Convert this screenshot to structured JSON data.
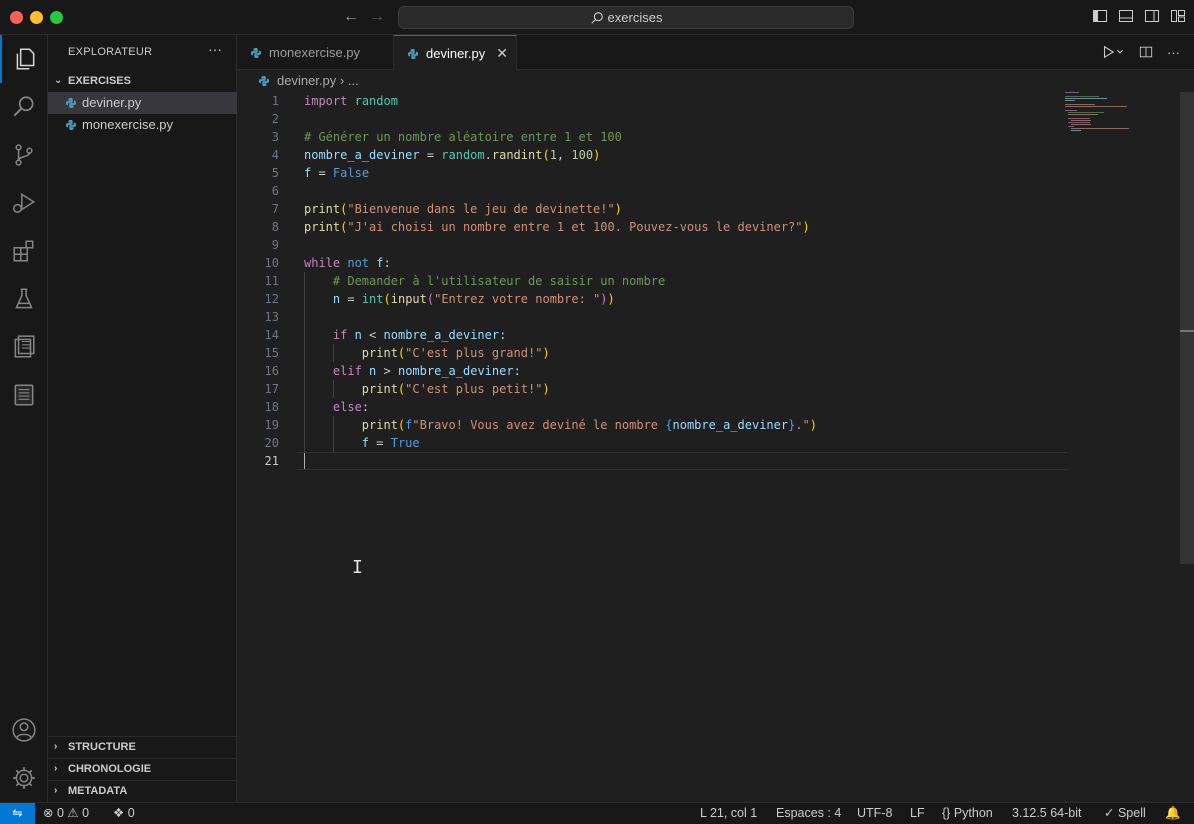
{
  "titlebar": {
    "search_text": "exercises",
    "icons": [
      "arrow-left-icon",
      "arrow-right-icon",
      "search-icon",
      "toggle-sidebar-icon",
      "toggle-panel-icon",
      "toggle-secondary-sidebar-icon",
      "customize-layout-icon"
    ]
  },
  "activitybar": {
    "items": [
      "explorer-icon",
      "search-icon",
      "source-control-icon",
      "run-debug-icon",
      "extensions-icon",
      "testing-icon",
      "remote-explorer-icon",
      "notebook-icon"
    ],
    "bottom": [
      "account-icon",
      "manage-gear-icon"
    ]
  },
  "sidebar": {
    "title": "EXPLORATEUR",
    "more": "···",
    "folder": "EXERCISES",
    "files": [
      "deviner.py",
      "monexercise.py"
    ],
    "sections": [
      "STRUCTURE",
      "CHRONOLOGIE",
      "METADATA"
    ]
  },
  "tabs": [
    {
      "label": "monexercise.py",
      "active": false
    },
    {
      "label": "deviner.py",
      "active": true
    }
  ],
  "tab_close": "✕",
  "breadcrumb": {
    "file": "deviner.py",
    "sep": "›",
    "rest": "..."
  },
  "editor": {
    "line_numbers": [
      "1",
      "2",
      "3",
      "4",
      "5",
      "6",
      "7",
      "8",
      "9",
      "10",
      "11",
      "12",
      "13",
      "14",
      "15",
      "16",
      "17",
      "18",
      "19",
      "20",
      "21"
    ],
    "current_line": 21,
    "colors": {
      "keyword": "#c586c0",
      "builtin": "#569cd6",
      "function": "#dcdcaa",
      "variable": "#9cdcfe",
      "string": "#ce9178",
      "number": "#b5cea8",
      "comment": "#6a9955"
    }
  },
  "statusbar": {
    "errors": "0",
    "warnings": "0",
    "ports": "0",
    "position": "L 21, col 1",
    "spaces": "Espaces : 4",
    "encoding": "UTF-8",
    "eol": "LF",
    "language": "Python",
    "interpreter": "3.12.5 64-bit",
    "spell": "Spell",
    "accent": "#0078d4"
  }
}
